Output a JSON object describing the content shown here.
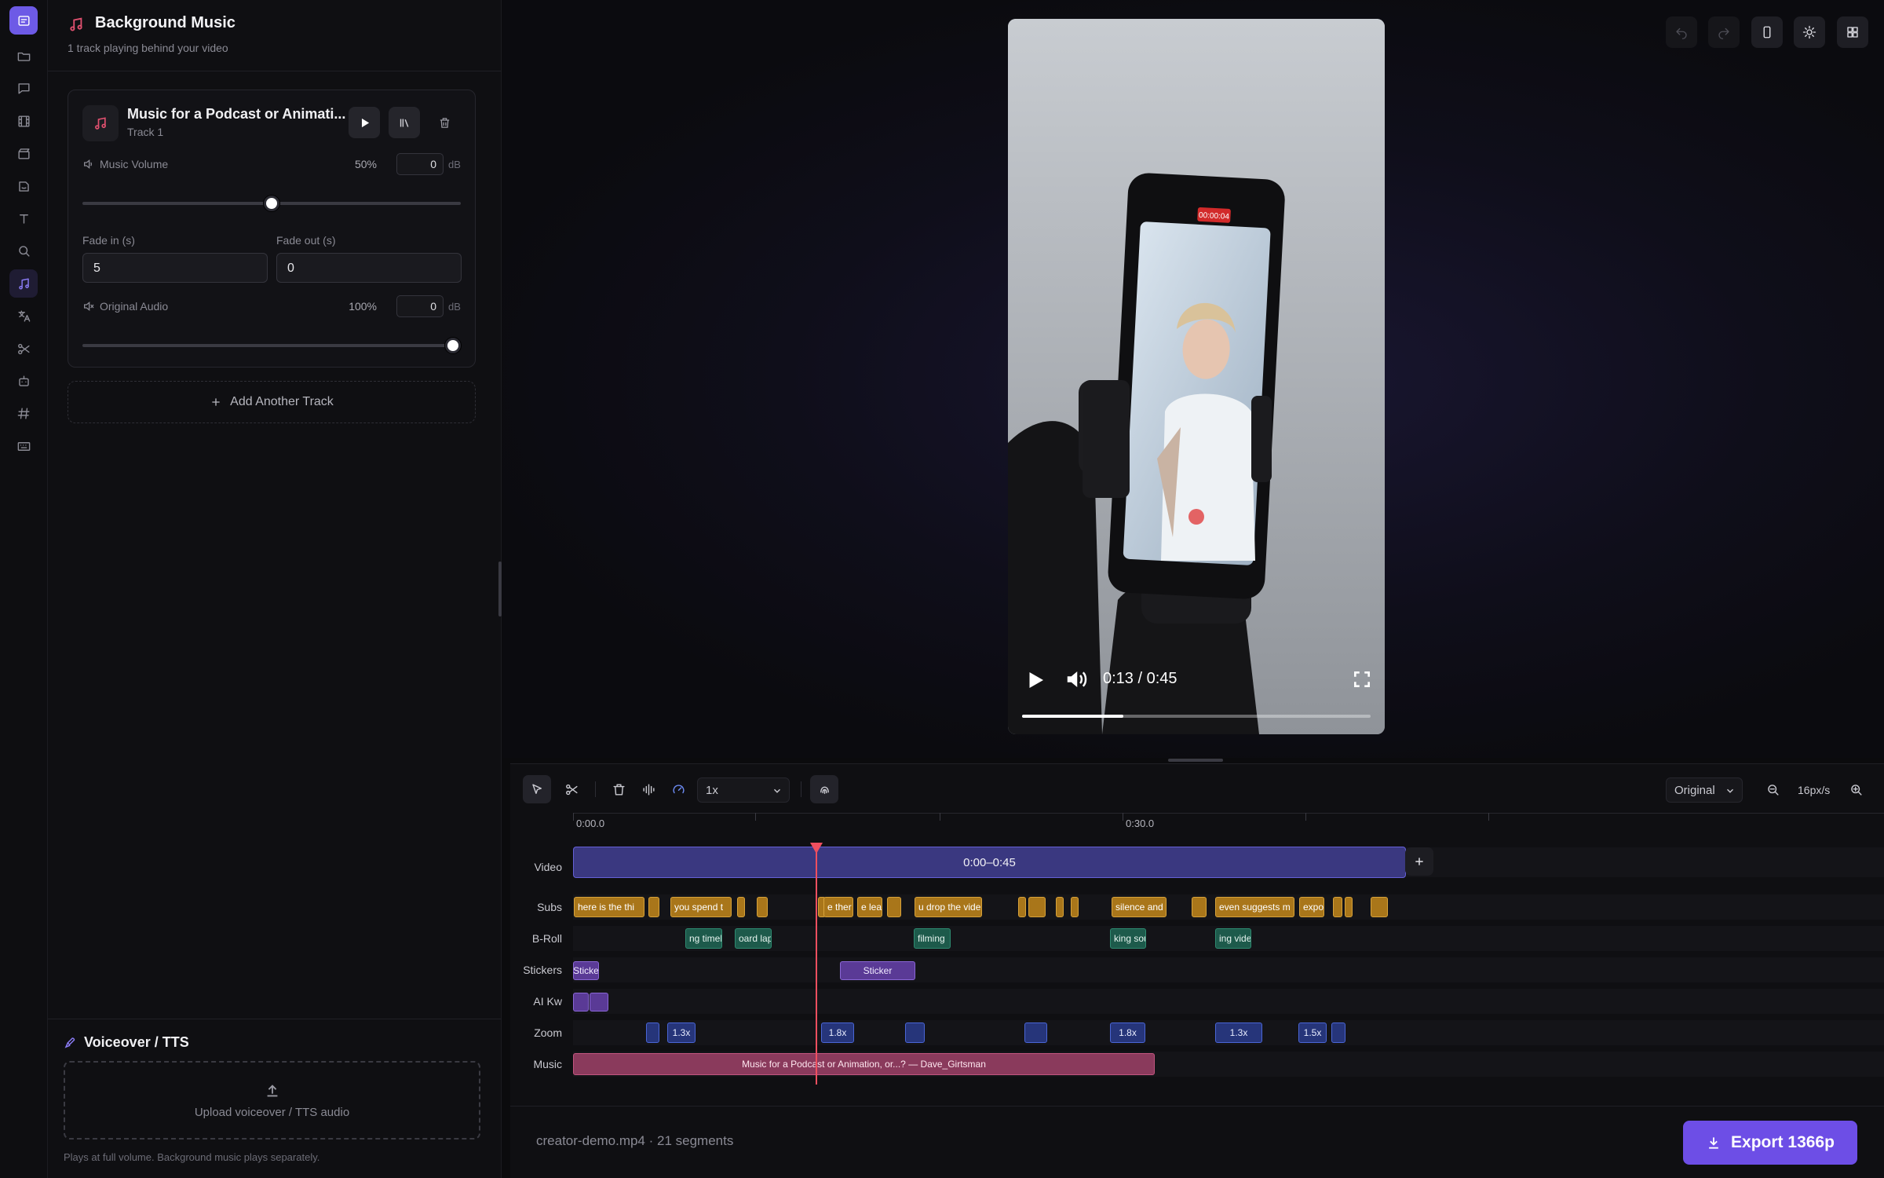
{
  "panel": {
    "title": "Background Music",
    "subtitle": "1 track playing behind your video",
    "track": {
      "name": "Music for a Podcast or Animati...",
      "sub": "Track 1"
    },
    "music_volume": {
      "label": "Music Volume",
      "percent": "50%",
      "db": "0",
      "unit": "dB",
      "level": 0.5
    },
    "fade_in": {
      "label": "Fade in (s)",
      "value": "5"
    },
    "fade_out": {
      "label": "Fade out (s)",
      "value": "0"
    },
    "original_audio": {
      "label": "Original Audio",
      "percent": "100%",
      "db": "0",
      "unit": "dB",
      "level": 1.0
    },
    "add_track": "Add Another Track",
    "voiceover": {
      "title": "Voiceover / TTS",
      "upload": "Upload voiceover / TTS audio",
      "note": "Plays at full volume. Background music plays separately."
    }
  },
  "player": {
    "time": "0:13 / 0:45",
    "progress": 0.29,
    "phone_badge": "00:00:04"
  },
  "timeline": {
    "speed": "1x",
    "quality": "Original",
    "zoom": "16px/s",
    "ticks": [
      "0:00.0",
      "0:30.0"
    ],
    "rows": {
      "video": "Video",
      "subs": "Subs",
      "broll": "B-Roll",
      "stickers": "Stickers",
      "aikw": "AI Kw",
      "zoom": "Zoom",
      "music": "Music"
    },
    "video_clip": "0:00–0:45",
    "subs": [
      "here is the thi",
      "",
      "you spend t",
      "",
      "",
      "",
      "e ther",
      "e leas",
      "",
      "u drop the vide",
      "",
      "",
      "",
      "",
      "silence and",
      "",
      "even suggests m",
      "expo",
      "",
      "",
      ""
    ],
    "broll": [
      "ng timel",
      "oard lap",
      "filming",
      "king sou",
      "ing vide"
    ],
    "stickers": [
      "Sticke",
      "Sticker"
    ],
    "zoom_clips": [
      "",
      "1.3x",
      "1.8x",
      "",
      "",
      "1.8x",
      "1.3x",
      "1.5x",
      ""
    ],
    "music_clip": "Music for a Podcast or Animation, or...? — Dave_Girtsman",
    "file": "creator-demo.mp4 · 21 segments",
    "export": "Export 1366p"
  },
  "colors": {
    "accent": "#6d4ee6",
    "playhead": "#ef4f5f",
    "music_icon": "#e0506f"
  }
}
